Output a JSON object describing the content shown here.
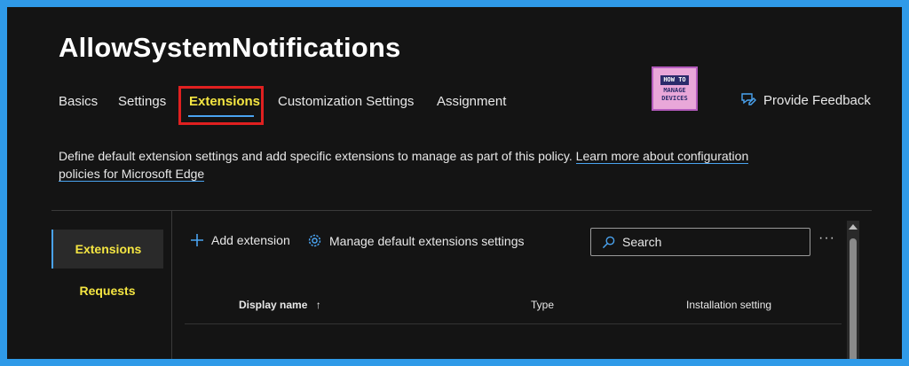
{
  "page": {
    "title": "AllowSystemNotifications"
  },
  "tabs": [
    {
      "label": "Basics",
      "active": false
    },
    {
      "label": "Settings",
      "active": false
    },
    {
      "label": "Extensions",
      "active": true
    },
    {
      "label": "Customization Settings",
      "active": false
    },
    {
      "label": "Assignment",
      "active": false
    }
  ],
  "logo": {
    "line1": "HOW TO",
    "line2": "MANAGE",
    "line3": "DEVICES"
  },
  "feedback": {
    "label": "Provide Feedback",
    "icon": "feedback-icon"
  },
  "description": {
    "text": "Define default extension settings and add specific extensions to manage as part of this policy.",
    "link_text": "Learn more about configuration policies for Microsoft Edge"
  },
  "sidebar": {
    "items": [
      {
        "label": "Extensions",
        "active": true
      },
      {
        "label": "Requests",
        "active": false
      }
    ]
  },
  "toolbar": {
    "add_label": "Add extension",
    "add_icon": "plus-icon",
    "manage_label": "Manage default extensions settings",
    "manage_icon": "gear-icon",
    "more_label": "···"
  },
  "search": {
    "placeholder": "Search",
    "icon": "search-icon"
  },
  "table": {
    "columns": [
      {
        "label": "Display name",
        "sort": "↑"
      },
      {
        "label": "Type"
      },
      {
        "label": "Installation setting"
      }
    ]
  },
  "colors": {
    "border_blue": "#2f9ae8",
    "active_yellow": "#f5e642",
    "accent_blue": "#4aa3f0",
    "highlight_red": "#e02020"
  }
}
